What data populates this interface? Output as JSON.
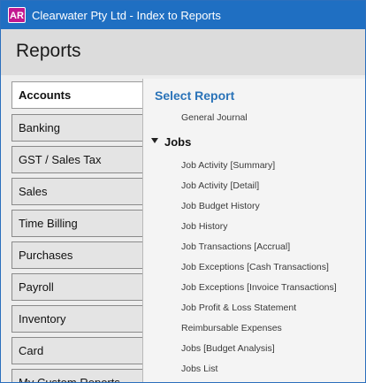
{
  "titlebar": {
    "app_icon": "AR",
    "title": "Clearwater Pty Ltd - Index to Reports"
  },
  "header": {
    "title": "Reports"
  },
  "categories": [
    {
      "label": "Accounts",
      "active": true
    },
    {
      "label": "Banking"
    },
    {
      "label": "GST / Sales Tax"
    },
    {
      "label": "Sales"
    },
    {
      "label": "Time Billing"
    },
    {
      "label": "Purchases"
    },
    {
      "label": "Payroll"
    },
    {
      "label": "Inventory"
    },
    {
      "label": "Card"
    },
    {
      "label": "My Custom Reports"
    }
  ],
  "panel": {
    "header": "Select Report",
    "top_item": "General Journal",
    "group": {
      "label": "Jobs",
      "icon": "caret-down-icon"
    },
    "items": [
      "Job Activity [Summary]",
      "Job Activity [Detail]",
      "Job Budget History",
      "Job History",
      "Job Transactions [Accrual]",
      "Job Exceptions [Cash Transactions]",
      "Job Exceptions [Invoice Transactions]",
      "Job Profit & Loss Statement",
      "Reimbursable Expenses",
      "Jobs [Budget Analysis]",
      "Jobs List"
    ]
  },
  "colors": {
    "titlebar": "#1f6fc2",
    "accent": "#2a73b8",
    "app_icon": "#c2188f"
  }
}
